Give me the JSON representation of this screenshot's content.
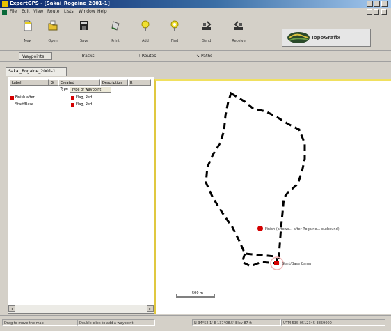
{
  "window": {
    "title": "ExpertGPS - [Sakai_Rogaine_2001-1]",
    "minimize_label": "_",
    "maximize_label": "□",
    "close_label": "×"
  },
  "menu": [
    "File",
    "Edit",
    "View",
    "Route",
    "Lists",
    "Window",
    "Help"
  ],
  "toolbar": [
    {
      "label": "New",
      "icon": "new-file-icon"
    },
    {
      "label": "Open",
      "icon": "open-folder-icon"
    },
    {
      "label": "Save",
      "icon": "save-disk-icon"
    },
    {
      "label": "Print",
      "icon": "print-icon"
    },
    {
      "label": "Add",
      "icon": "add-waypoint-icon"
    },
    {
      "label": "Find",
      "icon": "find-icon"
    },
    {
      "label": "Send",
      "icon": "send-gps-icon"
    },
    {
      "label": "Receive",
      "icon": "receive-gps-icon"
    }
  ],
  "logo": {
    "text": "TopoGrafix"
  },
  "modes": [
    {
      "label": "Waypoints",
      "active": true
    },
    {
      "label": "Tracks",
      "active": false
    },
    {
      "label": "Routes",
      "active": false
    },
    {
      "label": "Paths",
      "active": false
    }
  ],
  "document_tab": "Sakai_Rogaine_2001-1",
  "table": {
    "columns": [
      "Label",
      "G",
      "Created",
      "Description",
      "R"
    ],
    "subcolumns": [
      "Type",
      "Type of waypoint"
    ],
    "rows": [
      {
        "name": "Finish after...",
        "type": "Flag, Red"
      },
      {
        "name": "Start/Base...",
        "type": "Flag, Red"
      }
    ]
  },
  "map": {
    "waypoints": [
      {
        "label": "Finish (arrows... after Rogaine... outbound)"
      },
      {
        "label": "Start/Base Camp"
      }
    ],
    "scale_label": "500 m"
  },
  "status": [
    "Drag to move the map",
    "Double-click to add a waypoint",
    "N 34°52.1' E 137°08.5'  Elev 87 ft",
    "UTM 53S 0512345 3859000"
  ]
}
